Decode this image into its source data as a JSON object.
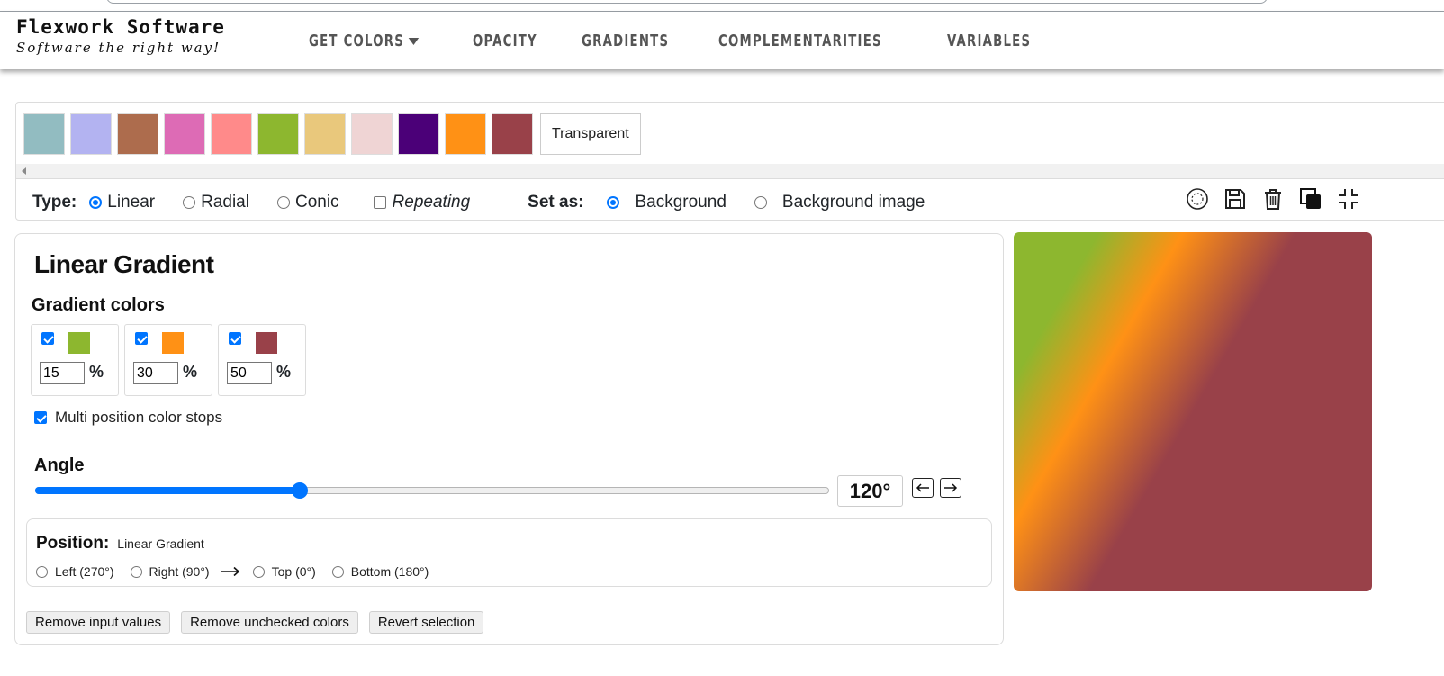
{
  "brand": {
    "name": "Flexwork Software",
    "tagline": "Software the right way!"
  },
  "nav": {
    "get_colors": "GET COLORS",
    "opacity": "OPACITY",
    "gradients": "GRADIENTS",
    "complementarities": "COMPLEMENTARITIES",
    "variables": "VARIABLES"
  },
  "swatches": [
    "#92bcc1",
    "#b3b3f1",
    "#ad6c4d",
    "#dd6bb5",
    "#ff8a8a",
    "#8db72f",
    "#e9c87c",
    "#efd4d4",
    "#4b0078",
    "#ff9115",
    "#994149"
  ],
  "transparent_label": "Transparent",
  "type_row": {
    "type_label": "Type:",
    "linear": "Linear",
    "radial": "Radial",
    "conic": "Conic",
    "repeating": "Repeating",
    "set_as_label": "Set as:",
    "background": "Background",
    "background_image": "Background image"
  },
  "tool_icons": [
    "target-icon",
    "save-icon",
    "trash-icon",
    "layers-icon",
    "collapse-icon"
  ],
  "panel": {
    "title": "Linear Gradient",
    "gradient_colors_label": "Gradient colors",
    "stops": [
      {
        "color": "#8db72f",
        "position": "15",
        "unit": "%"
      },
      {
        "color": "#ff9115",
        "position": "30",
        "unit": "%"
      },
      {
        "color": "#994149",
        "position": "50",
        "unit": "%"
      }
    ],
    "multi_position_label": "Multi position color stops",
    "angle_label": "Angle",
    "angle_value": 120,
    "angle_display": "120°",
    "angle_max": 360,
    "position_label": "Position:",
    "position_sub": "Linear Gradient",
    "positions": {
      "left": "Left (270°)",
      "right": "Right (90°)",
      "top": "Top (0°)",
      "bottom": "Bottom (180°)"
    },
    "buttons": {
      "remove_inputs": "Remove input values",
      "remove_unchecked": "Remove unchecked colors",
      "revert": "Revert selection"
    }
  }
}
